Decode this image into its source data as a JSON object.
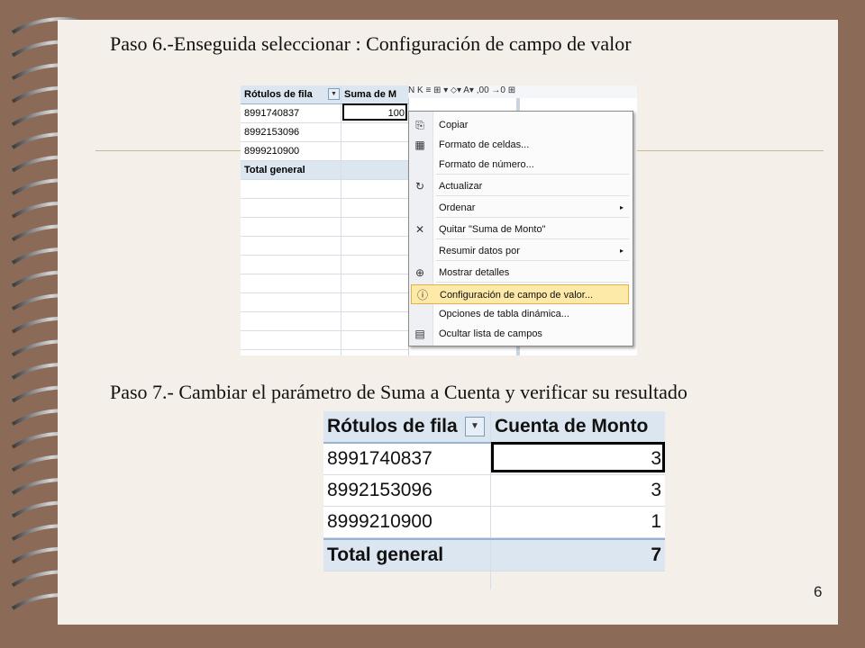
{
  "slide": {
    "step6_title": "Paso 6.-Enseguida seleccionar : Configuración de campo de valor",
    "step7_title": "Paso 7.- Cambiar el parámetro de Suma a Cuenta y verificar su resultado",
    "page_number": "6",
    "colors": {
      "background": "#8b6a57",
      "paper": "#f4efe9",
      "table_header": "#dce6f1",
      "menu_highlight": "#fde9a8"
    }
  },
  "pivot1": {
    "col_header_row": "Rótulos de fila",
    "col_header_value": "Suma de M",
    "rows": [
      {
        "label": "8991740837",
        "value": "100"
      },
      {
        "label": "8992153096",
        "value": ""
      },
      {
        "label": "8999210900",
        "value": ""
      }
    ],
    "total_label": "Total general",
    "toolbar_text": "N  K  ≡  ⊞ ▾  ⬦▾  A▾   ,00  →0  ⊞"
  },
  "context_menu": {
    "items": [
      {
        "label": "Copiar",
        "icon": "copy-icon",
        "glyph": "⎘"
      },
      {
        "label": "Formato de celdas...",
        "icon": "format-cells-icon",
        "glyph": "▦"
      },
      {
        "label": "Formato de número...",
        "icon": "",
        "glyph": ""
      },
      {
        "label": "Actualizar",
        "icon": "refresh-icon",
        "glyph": "↻"
      },
      {
        "label": "Ordenar",
        "icon": "",
        "glyph": "",
        "submenu": "▸"
      },
      {
        "label": "Quitar \"Suma de Monto\"",
        "icon": "remove-icon",
        "glyph": "✕"
      },
      {
        "label": "Resumir datos por",
        "icon": "",
        "glyph": "",
        "submenu": "▸"
      },
      {
        "label": "Mostrar detalles",
        "icon": "show-details-icon",
        "glyph": "⊕"
      },
      {
        "label": "Configuración de campo de valor...",
        "icon": "value-field-settings-icon",
        "glyph": "ⓘ"
      },
      {
        "label": "Opciones de tabla dinámica...",
        "icon": "",
        "glyph": ""
      },
      {
        "label": "Ocultar lista de campos",
        "icon": "field-list-icon",
        "glyph": "▤"
      }
    ]
  },
  "pivot2": {
    "col_header_row": "Rótulos de fila",
    "col_header_value": "Cuenta de Monto",
    "dropdown_glyph": "▼",
    "rows": [
      {
        "label": "8991740837",
        "value": "3"
      },
      {
        "label": "8992153096",
        "value": "3"
      },
      {
        "label": "8999210900",
        "value": "1"
      }
    ],
    "total_label": "Total general",
    "total_value": "7"
  }
}
